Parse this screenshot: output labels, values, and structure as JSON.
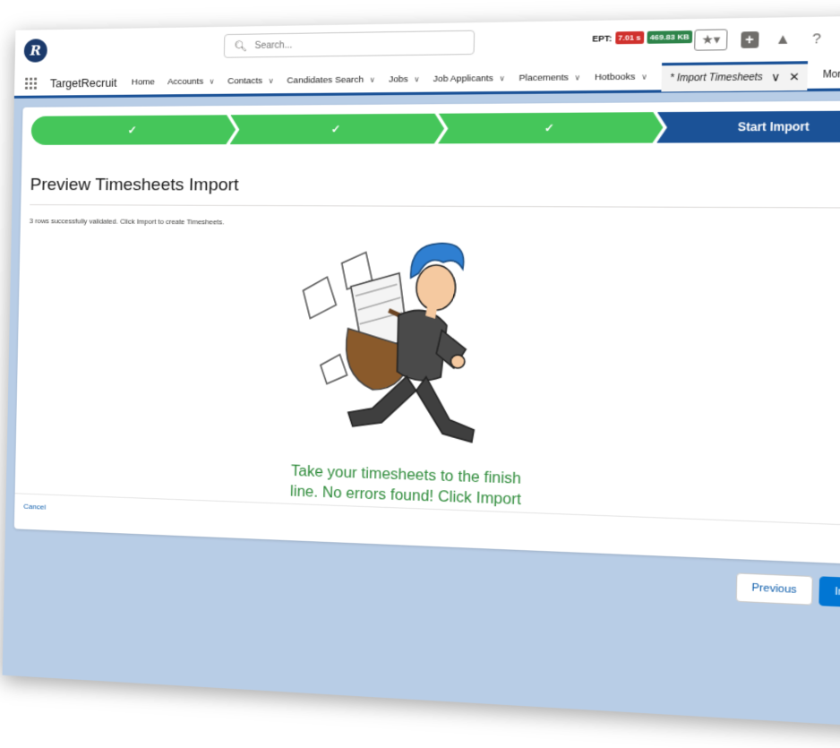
{
  "header": {
    "search_placeholder": "Search...",
    "ept_label": "EPT:",
    "ept_time": "7.01 s",
    "ept_size": "469.83 KB"
  },
  "nav": {
    "app_name": "TargetRecruit",
    "items": [
      {
        "label": "Home",
        "has_menu": false
      },
      {
        "label": "Accounts",
        "has_menu": true
      },
      {
        "label": "Contacts",
        "has_menu": true
      },
      {
        "label": "Candidates Search",
        "has_menu": true
      },
      {
        "label": "Jobs",
        "has_menu": true
      },
      {
        "label": "Job Applicants",
        "has_menu": true
      },
      {
        "label": "Placements",
        "has_menu": true
      },
      {
        "label": "Hotbooks",
        "has_menu": true
      }
    ],
    "active_tab": "* Import Timesheets",
    "more_label": "More"
  },
  "path": {
    "steps": [
      {
        "label": "✓",
        "state": "done"
      },
      {
        "label": "✓",
        "state": "done"
      },
      {
        "label": "✓",
        "state": "done"
      },
      {
        "label": "Start Import",
        "state": "current"
      }
    ]
  },
  "main": {
    "title": "Preview Timesheets Import",
    "status_text": "3 rows successfully validated. Click Import to create Timesheets.",
    "message_line1": "Take your timesheets to the finish",
    "message_line2": "line. No errors found! Click Import",
    "cancel_label": "Cancel"
  },
  "footer": {
    "previous_label": "Previous",
    "import_label": "Import"
  },
  "colors": {
    "brand_blue": "#1b5297",
    "step_done_green": "#45c65a",
    "message_green": "#2e8b3a",
    "button_blue": "#0176d3",
    "page_background": "#b8cde6"
  }
}
